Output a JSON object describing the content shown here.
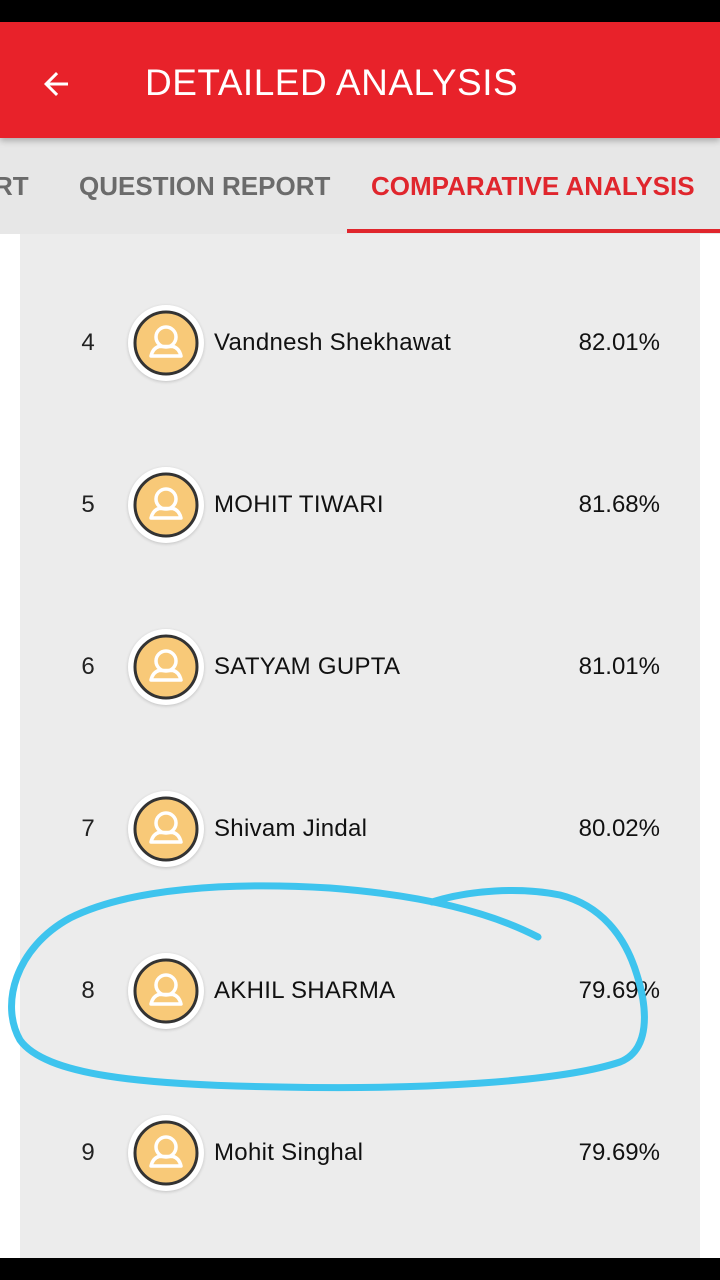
{
  "header": {
    "title": "DETAILED ANALYSIS",
    "back_icon": "arrow-left-icon",
    "background_color": "#e8222a"
  },
  "tabs": [
    {
      "label": "REPORT",
      "visible_text": "RT",
      "active": false
    },
    {
      "label": "QUESTION REPORT",
      "active": false
    },
    {
      "label": "COMPARATIVE ANALYSIS",
      "active": true
    }
  ],
  "accent_color": "#e0262d",
  "rankings": [
    {
      "rank": "4",
      "name": "Vandnesh Shekhawat",
      "percentage": "82.01%"
    },
    {
      "rank": "5",
      "name": "MOHIT TIWARI",
      "percentage": "81.68%"
    },
    {
      "rank": "6",
      "name": "SATYAM GUPTA",
      "percentage": "81.01%"
    },
    {
      "rank": "7",
      "name": "Shivam Jindal",
      "percentage": "80.02%"
    },
    {
      "rank": "8",
      "name": "AKHIL SHARMA",
      "percentage": "79.69%"
    },
    {
      "rank": "9",
      "name": "Mohit Singhal",
      "percentage": "79.69%"
    }
  ],
  "annotation": {
    "shape": "hand-drawn-circle",
    "color": "#3ec4ee",
    "highlighted_rank": "8"
  }
}
